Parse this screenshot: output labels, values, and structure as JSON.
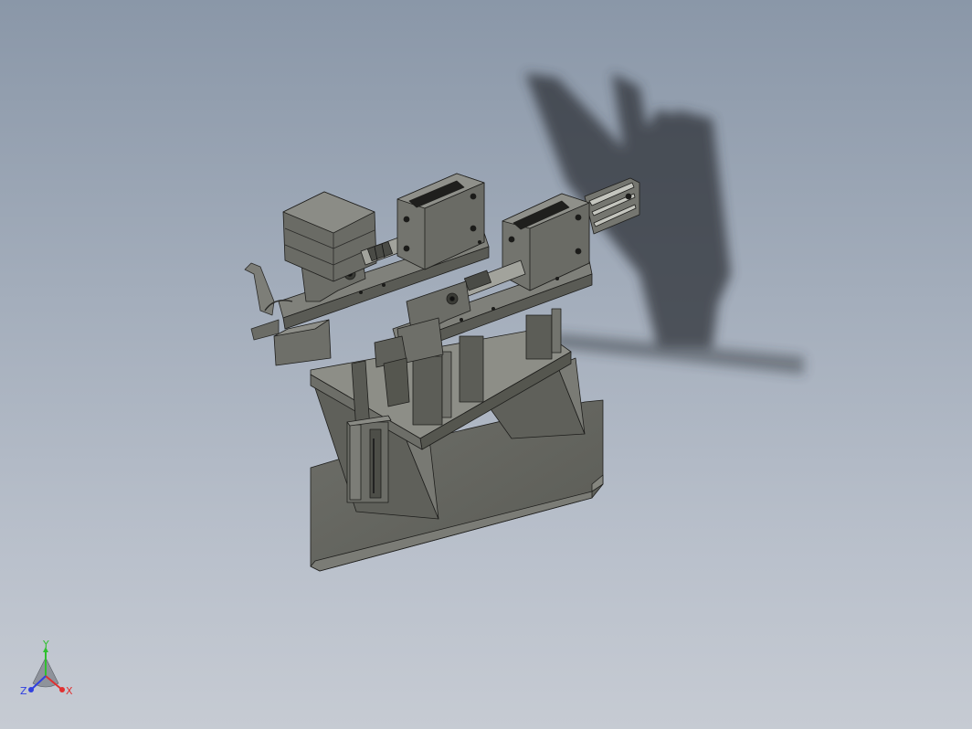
{
  "viewport": {
    "background_top": "#8a97a8",
    "background_bottom": "#c6cbd3"
  },
  "model": {
    "part_color": "#6f706a",
    "part_dark": "#4e4f4a",
    "part_light": "#8c8d86",
    "edge_color": "#1e1e1c",
    "shadow_color": "#2f3338"
  },
  "triad": {
    "x_label": "X",
    "y_label": "Y",
    "z_label": "Z",
    "x_color": "#e03030",
    "y_color": "#30c030",
    "z_color": "#3040e0"
  }
}
